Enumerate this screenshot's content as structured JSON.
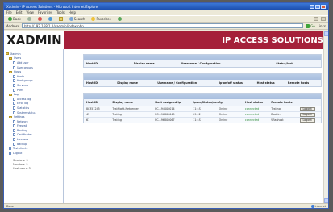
{
  "window": {
    "title": "Xadmin - IP Access Solutions - Microsoft Internet Explorer"
  },
  "menu": [
    "File",
    "Edit",
    "View",
    "Favorites",
    "Tools",
    "Help"
  ],
  "toolbar": {
    "back": "Back",
    "forward": "",
    "search": "Search",
    "favorites": "Favorites"
  },
  "address": {
    "label": "Address",
    "value": "http://192.168.1.1/xadmin/index.php",
    "go": "Go",
    "links": "Links"
  },
  "brand": {
    "logo": "XADMIN",
    "tagline": "IP ACCESS SOLUTIONS"
  },
  "sidebar": {
    "items": [
      {
        "label": "Xadmin",
        "level": 0,
        "type": "folder"
      },
      {
        "label": "Users",
        "level": 1,
        "type": "folder"
      },
      {
        "label": "Add user",
        "level": 2,
        "type": "doc"
      },
      {
        "label": "User groups",
        "level": 2,
        "type": "doc"
      },
      {
        "label": "Hosts",
        "level": 1,
        "type": "folder"
      },
      {
        "label": "Hosts",
        "level": 2,
        "type": "doc"
      },
      {
        "label": "Host groups",
        "level": 2,
        "type": "doc"
      },
      {
        "label": "Services",
        "level": 2,
        "type": "doc"
      },
      {
        "label": "Ports",
        "level": 2,
        "type": "doc"
      },
      {
        "label": "Log",
        "level": 1,
        "type": "folder"
      },
      {
        "label": "Access log",
        "level": 2,
        "type": "doc"
      },
      {
        "label": "Error log",
        "level": 2,
        "type": "doc"
      },
      {
        "label": "Statistics",
        "level": 2,
        "type": "doc"
      },
      {
        "label": "System status",
        "level": 2,
        "type": "doc"
      },
      {
        "label": "Settings",
        "level": 1,
        "type": "folder"
      },
      {
        "label": "Network",
        "level": 2,
        "type": "doc"
      },
      {
        "label": "Firewall",
        "level": 2,
        "type": "doc"
      },
      {
        "label": "Routing",
        "level": 2,
        "type": "doc"
      },
      {
        "label": "Certificates",
        "level": 2,
        "type": "doc"
      },
      {
        "label": "Licenses",
        "level": 2,
        "type": "doc"
      },
      {
        "label": "Backup",
        "level": 2,
        "type": "doc"
      },
      {
        "label": "Test clients",
        "level": 1,
        "type": "doc"
      },
      {
        "label": "Logout",
        "level": 1,
        "type": "doc"
      }
    ],
    "footer": [
      "Sessions: 3",
      "Monitors: 3",
      "Host users: 3"
    ]
  },
  "panels": {
    "p1": {
      "columns": [
        "Host ID",
        "Display name",
        "Username / Configuration",
        "Status/last"
      ]
    },
    "p2": {
      "columns": [
        "Host ID",
        "Display name",
        "Username / Configuration",
        "Ip-on/off status",
        "Host status",
        "Remote hosts"
      ]
    },
    "p3": {
      "columns": [
        "Host ID",
        "Display name",
        "Host assigned ip",
        "Ipsec/Status/config",
        "Host status",
        "Remote hosts"
      ],
      "rows": [
        {
          "id": "80351245",
          "name": "Testflight-Netcenter",
          "ip": "PC-194000014",
          "cfg": "11:1S",
          "extra": "Online",
          "status": "connected",
          "remote": "Testing",
          "action": "Logout"
        },
        {
          "id": "45",
          "name": "Testing",
          "ip": "PC-196800045",
          "cfg": "09:12",
          "extra": "Online",
          "status": "connected",
          "remote": "Bookin",
          "action": "Logout"
        },
        {
          "id": "67",
          "name": "Testing",
          "ip": "PC-196800067",
          "cfg": "11:1S",
          "extra": "Online",
          "status": "connected",
          "remote": "Wlanhost",
          "action": "Logout"
        }
      ]
    }
  },
  "status": {
    "left": "Done",
    "zone": "Internet"
  }
}
